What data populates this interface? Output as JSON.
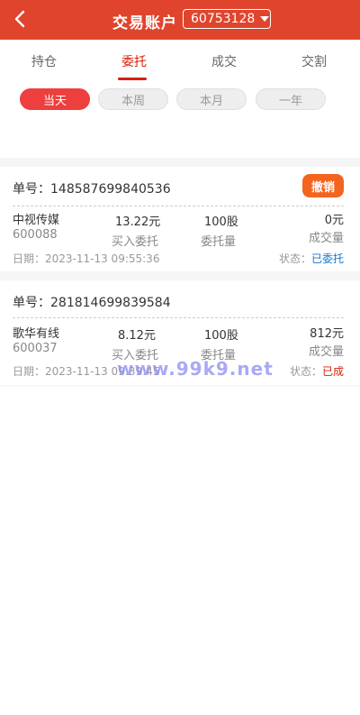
{
  "header": {
    "title": "交易账户",
    "account": "60753128"
  },
  "tabs": [
    "持仓",
    "委托",
    "成交",
    "交割"
  ],
  "periods": [
    "当天",
    "本周",
    "本月",
    "一年"
  ],
  "orders": [
    {
      "order_no": "单号：148587699840536",
      "action": "撤销",
      "name": "中视传媒",
      "code": "600088",
      "price": "13.22元",
      "price_label": "买入委托",
      "qty": "100股",
      "qty_label": "委托量",
      "filled": "0元",
      "filled_label": "成交量",
      "date": "日期：2023-11-13 09:55:36",
      "status_label": "状态：",
      "status": "已委托"
    },
    {
      "order_no": "单号：281814699839584",
      "name": "歌华有线",
      "code": "600037",
      "price": "8.12元",
      "price_label": "买入委托",
      "qty": "100股",
      "qty_label": "委托量",
      "filled": "812元",
      "filled_label": "成交量",
      "date": "日期：2023-11-13 09:39:45",
      "status_label": "状态：",
      "status": "已成"
    }
  ],
  "watermark": "www.99k9.net",
  "colors": {
    "header": "#e1442c",
    "active_tab": "#d81e06",
    "chip_active": "#ee3f3f",
    "cancel": "#f3641f",
    "status_pending": "#1478d2",
    "status_done": "#d81e06"
  }
}
